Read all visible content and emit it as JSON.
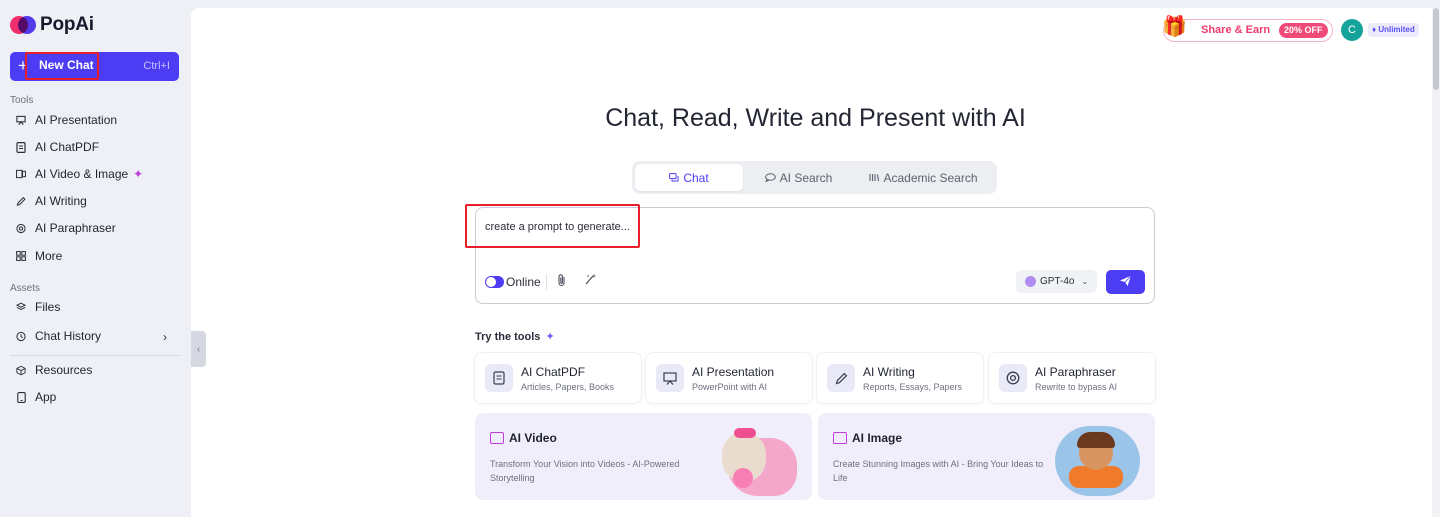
{
  "brand": {
    "name": "PopAi"
  },
  "sidebar": {
    "new_chat": {
      "plus": "+",
      "label": "New Chat",
      "shortcut": "Ctrl+I"
    },
    "tools_title": "Tools",
    "tools": [
      {
        "icon": "presentation-icon",
        "label": "AI Presentation"
      },
      {
        "icon": "document-icon",
        "label": "AI ChatPDF"
      },
      {
        "icon": "video-image-icon",
        "label": "AI Video & Image",
        "badge_icon": "sparkle-icon"
      },
      {
        "icon": "pen-icon",
        "label": "AI Writing"
      },
      {
        "icon": "paraphrase-icon",
        "label": "AI Paraphraser"
      },
      {
        "icon": "grid-icon",
        "label": "More"
      }
    ],
    "assets_title": "Assets",
    "assets": [
      {
        "icon": "layers-icon",
        "label": "Files"
      },
      {
        "icon": "clock-icon",
        "label": "Chat History"
      }
    ],
    "bottom": [
      {
        "icon": "cube-icon",
        "label": "Resources"
      },
      {
        "icon": "phone-icon",
        "label": "App"
      }
    ]
  },
  "header": {
    "share_label": "Share & Earn",
    "discount_badge": "20% OFF",
    "avatar_initial": "C",
    "plan_badge": "Unlimited"
  },
  "main": {
    "hero_title": "Chat, Read, Write and Present with AI",
    "tabs": [
      {
        "label": "Chat",
        "icon": "chat-icon",
        "active": true
      },
      {
        "label": "AI Search",
        "icon": "search-bubble-icon",
        "active": false
      },
      {
        "label": "Academic Search",
        "icon": "library-icon",
        "active": false
      }
    ],
    "input": {
      "value": "create a prompt to generate..."
    },
    "toolbar": {
      "online_label": "Online",
      "online_enabled": true
    },
    "model": {
      "label": "GPT-4o"
    },
    "try_title": "Try the tools",
    "tool_cards": [
      {
        "icon": "document-icon",
        "title": "AI ChatPDF",
        "subtitle": "Articles, Papers, Books"
      },
      {
        "icon": "presentation-icon",
        "title": "AI Presentation",
        "subtitle": "PowerPoint with AI"
      },
      {
        "icon": "pen-icon",
        "title": "AI Writing",
        "subtitle": "Reports, Essays, Papers"
      },
      {
        "icon": "paraphrase-icon",
        "title": "AI Paraphraser",
        "subtitle": "Rewrite to bypass AI"
      }
    ],
    "feature_cards": [
      {
        "icon": "video-icon",
        "title": "AI Video",
        "description": "Transform Your Vision into Videos - AI-Powered Storytelling"
      },
      {
        "icon": "image-icon",
        "title": "AI Image",
        "description": "Create Stunning Images with AI - Bring Your Ideas to Life"
      }
    ]
  },
  "colors": {
    "accent": "#4c3cf4",
    "highlight_box": "#e81e2a",
    "share_pink": "#f03b6f"
  }
}
